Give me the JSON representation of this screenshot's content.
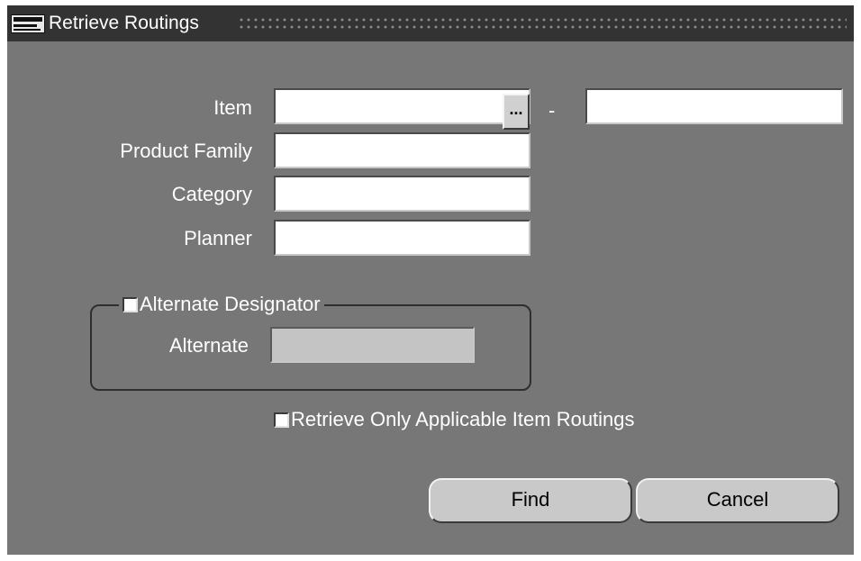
{
  "window": {
    "title": "Retrieve Routings",
    "logo_icon": "oracle-applications-logo-icon"
  },
  "form": {
    "item": {
      "label": "Item",
      "value_from": "",
      "value_to": "",
      "lov_label": "...",
      "range_separator": "-"
    },
    "product_family": {
      "label": "Product Family",
      "value": ""
    },
    "category": {
      "label": "Category",
      "value": ""
    },
    "planner": {
      "label": "Planner",
      "value": ""
    },
    "alternate_designator": {
      "label": "Alternate Designator",
      "checked": false,
      "alternate": {
        "label": "Alternate",
        "value": "",
        "enabled": false
      }
    },
    "applicable_only": {
      "label": "Retrieve Only Applicable Item Routings",
      "checked": false
    }
  },
  "buttons": {
    "find": "Find",
    "cancel": "Cancel"
  },
  "colors": {
    "canvas": "#777777",
    "titlebar": "#333333",
    "field": "#ffffff",
    "field_disabled": "#c4c4c4",
    "button": "#c9c9c9"
  }
}
